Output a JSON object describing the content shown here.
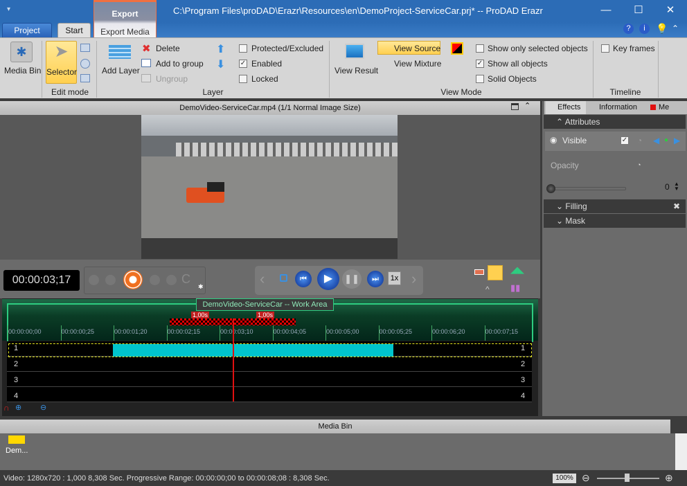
{
  "window": {
    "title": "C:\\Program Files\\proDAD\\Erazr\\Resources\\en\\DemoProject-ServiceCar.prj* -- ProDAD Erazr"
  },
  "tabs": {
    "project": "Project",
    "start": "Start",
    "export_context": "Export",
    "export_media": "Export Media"
  },
  "ribbon": {
    "media_bin": "Media Bin",
    "selector": "Selector",
    "edit_mode": "Edit mode",
    "add_layer": "Add Layer",
    "delete": "Delete",
    "add_to_group": "Add to group",
    "ungroup": "Ungroup",
    "layer": "Layer",
    "protected": "Protected/Excluded",
    "enabled": "Enabled",
    "locked": "Locked",
    "protected_checked": false,
    "enabled_checked": true,
    "locked_checked": false,
    "view_result": "View Result",
    "view_source": "View Source",
    "view_mixture": "View Mixture",
    "show_only_selected": "Show only selected objects",
    "show_all": "Show all objects",
    "solid_objects": "Solid Objects",
    "show_only_selected_checked": false,
    "show_all_checked": true,
    "solid_objects_checked": false,
    "view_mode": "View Mode",
    "key_frames": "Key frames",
    "timeline": "Timeline"
  },
  "preview": {
    "header": "DemoVideo-ServiceCar.mp4   (1/1  Normal Image Size)"
  },
  "transport": {
    "timecode": "00:00:03;17",
    "speed": "1x"
  },
  "timeline": {
    "work_area": "DemoVideo-ServiceCar -- Work Area",
    "marker1": "1,00s",
    "marker2": "1,00s",
    "ticks": [
      "00:00:00;00",
      "00:00:00;25",
      "00:00:01;20",
      "00:00:02;15",
      "00:00:03;10",
      "00:00:04;05",
      "00:00:05;00",
      "00:00:05;25",
      "00:00:06;20",
      "00:00:07;15"
    ],
    "tracks": [
      "1",
      "2",
      "3",
      "4"
    ]
  },
  "right_panel": {
    "tabs": [
      "Effects",
      "Information",
      "Me"
    ],
    "attributes": "Attributes",
    "visible": "Visible",
    "opacity": "Opacity",
    "opacity_value": "0",
    "filling": "Filling",
    "mask": "Mask"
  },
  "media_bin": {
    "header": "Media Bin",
    "item": "Dem..."
  },
  "status": {
    "info": "Video: 1280x720 : 1,000  8,308 Sec.  Progressive  Range: 00:00:00;00 to 00:00:08;08 : 8,308 Sec.",
    "zoom": "100%"
  },
  "colors": {
    "titlebar": "#2c6cb6",
    "export_accent": "#f07040",
    "clip": "#00c4cc",
    "playhead": "#e01010",
    "work_area": "#2ecc80"
  }
}
